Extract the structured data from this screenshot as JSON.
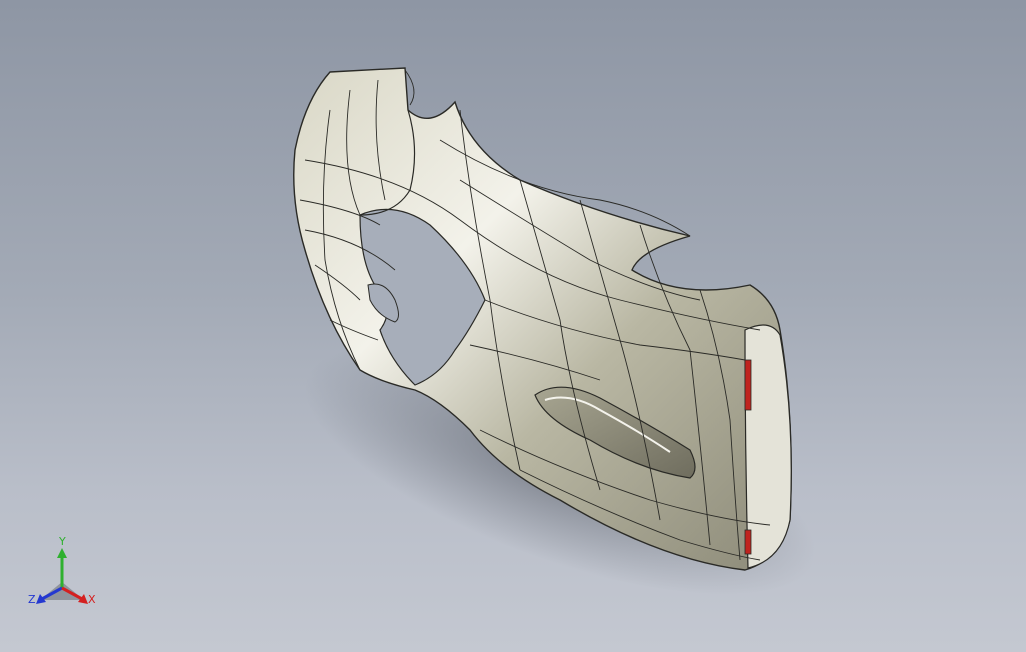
{
  "viewport": {
    "background_top": "#8e96a4",
    "background_bottom": "#c4c8d1"
  },
  "model": {
    "surface_color": "#c8c6b4",
    "edge_color": "#2a2a26",
    "accent_color": "#c0231e"
  },
  "triad": {
    "y_label": "Y",
    "z_label": "Z",
    "x_label": "X",
    "y_color": "#2fb02f",
    "z_color": "#2438d0",
    "x_color": "#d42020"
  }
}
